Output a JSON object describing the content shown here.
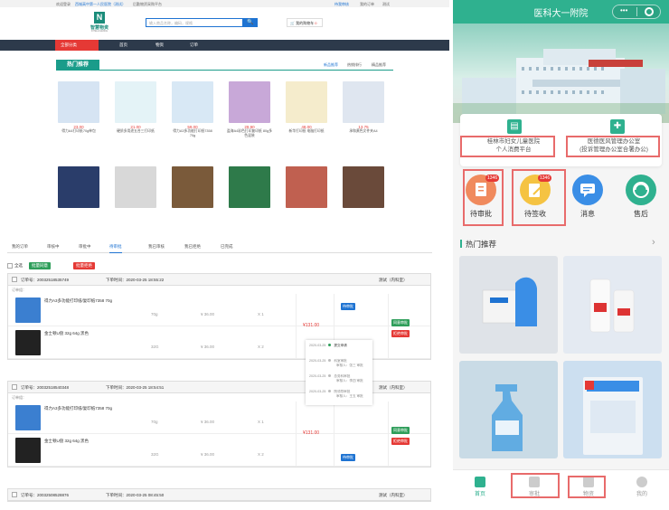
{
  "topbar": {
    "welcome": "欢迎登录",
    "user": "西城高中第一人民医院（测试）",
    "platform": "后勤物资采购平台",
    "links": [
      "待我审核",
      "我的订单",
      "测试"
    ]
  },
  "logo": {
    "cn": "智慧物资",
    "en": "INTELLIGENCE",
    "mark": "N"
  },
  "search": {
    "placeholder": "输入商品名称，编码，规格",
    "button": "🔍"
  },
  "cart": {
    "label": "我的购物车",
    "count": "0"
  },
  "nav": {
    "category": "全部分类",
    "items": [
      "首页",
      "物资",
      "订单"
    ]
  },
  "hot": {
    "title": "热门推荐",
    "tabs": [
      "新品推荐",
      "热销排行",
      "精品推荐"
    ]
  },
  "products_row1": [
    {
      "price": "23.00",
      "name": "得力A4打印纸70g单包",
      "color": "#d6e4f3"
    },
    {
      "price": "21.00",
      "name": "硬质多用途五合三打印纸",
      "color": "#e4f3f7"
    },
    {
      "price": "59.00",
      "name": "得力A3多功能打印纸7358 70g",
      "color": "#d8e8f5"
    },
    {
      "price": "29.90",
      "name": "盈海A4彩色打印复印纸 80g多色混装",
      "color": "#c8a8d8"
    },
    {
      "price": "48.00",
      "name": "新华打印纸 电脑打印纸",
      "color": "#f5eccc"
    },
    {
      "price": "13.75",
      "name": "承和黄色文件夹A4",
      "color": "#dfe6f0"
    }
  ],
  "products_row2": [
    {
      "color": "#2a3d6a"
    },
    {
      "color": "#d8d8d8"
    },
    {
      "color": "#7a5a3a"
    },
    {
      "color": "#2e7a4a"
    },
    {
      "color": "#c06050"
    },
    {
      "color": "#6a4a3a"
    }
  ],
  "order_tabs": [
    "我的订单",
    "审核中",
    "审批中",
    "待审批",
    "我已审核",
    "我已拒绝",
    "已完成"
  ],
  "bulk": {
    "select_all": "全选",
    "approve": "批量同意",
    "reject": "批量拒绝"
  },
  "orders": [
    {
      "no": "订单号：20032518535749",
      "time": "下单时间：2020-03-25 18:55:22",
      "dept": "测试（内科室）",
      "group": "订单组：",
      "items": [
        {
          "name": "得力A3多功能打印纸/复印纸7358 70g",
          "spec": "70g",
          "price": "¥ 36.00",
          "qty": "X 1",
          "color": "#3b7fd0"
        },
        {
          "name": "金士顿U盘 32g 64g 黑色",
          "spec": "32G",
          "price": "¥ 36.00",
          "qty": "X 2",
          "color": "#222"
        }
      ],
      "total": "¥131.00",
      "status": "待审批",
      "approve": "同意审批",
      "reject": "拒绝审批"
    },
    {
      "no": "订单号：20032518540348",
      "time": "下单时间：2020-03-25 18:54:51",
      "dept": "测试（内科室）",
      "group": "订单组：",
      "items": [
        {
          "name": "得力A3多功能打印纸/复印纸7358 70g",
          "spec": "70g",
          "price": "¥ 36.00",
          "qty": "X 1",
          "color": "#3b7fd0"
        },
        {
          "name": "金士顿U盘 32g 64g 黑色",
          "spec": "32G",
          "price": "¥ 36.00",
          "qty": "X 2",
          "color": "#222"
        }
      ],
      "total": "¥131.00",
      "status": "待审批",
      "approve": "同意审批",
      "reject": "拒绝审批"
    },
    {
      "no": "订单号：20032508528876",
      "time": "下单时间：2020-03-25 08:45:50",
      "dept": "测试（内科室）"
    }
  ],
  "popup": [
    {
      "date": "2020-03-25",
      "text": "提交申请"
    },
    {
      "date": "2020-03-25",
      "text": "科室审批",
      "sub": "审核人：张三 审批"
    },
    {
      "date": "2020-03-25",
      "text": "总务科审批",
      "sub": "审核人：李四 审批"
    },
    {
      "date": "2020-03-25",
      "text": "院领导审批",
      "sub": "审核人：王五 审批"
    }
  ],
  "mobile": {
    "title": "医科大一附院",
    "capsule": "•••",
    "card": [
      {
        "line1": "桂林市妇女儿童医院",
        "line2": "个人消费平台"
      },
      {
        "line1": "医德医风管理办公室",
        "line2": "(投诉管理办公室合署办公)"
      }
    ],
    "shortcuts": [
      {
        "label": "待审批",
        "badge": "1346",
        "color": "#f08a5d"
      },
      {
        "label": "待签收",
        "badge": "1346",
        "color": "#f5c342"
      },
      {
        "label": "消息",
        "color": "#3a8ee6"
      },
      {
        "label": "售后",
        "color": "#2fb18f"
      }
    ],
    "hot": "热门推荐",
    "more": "›",
    "tabs": [
      "首页",
      "审批",
      "物资",
      "我的"
    ]
  }
}
